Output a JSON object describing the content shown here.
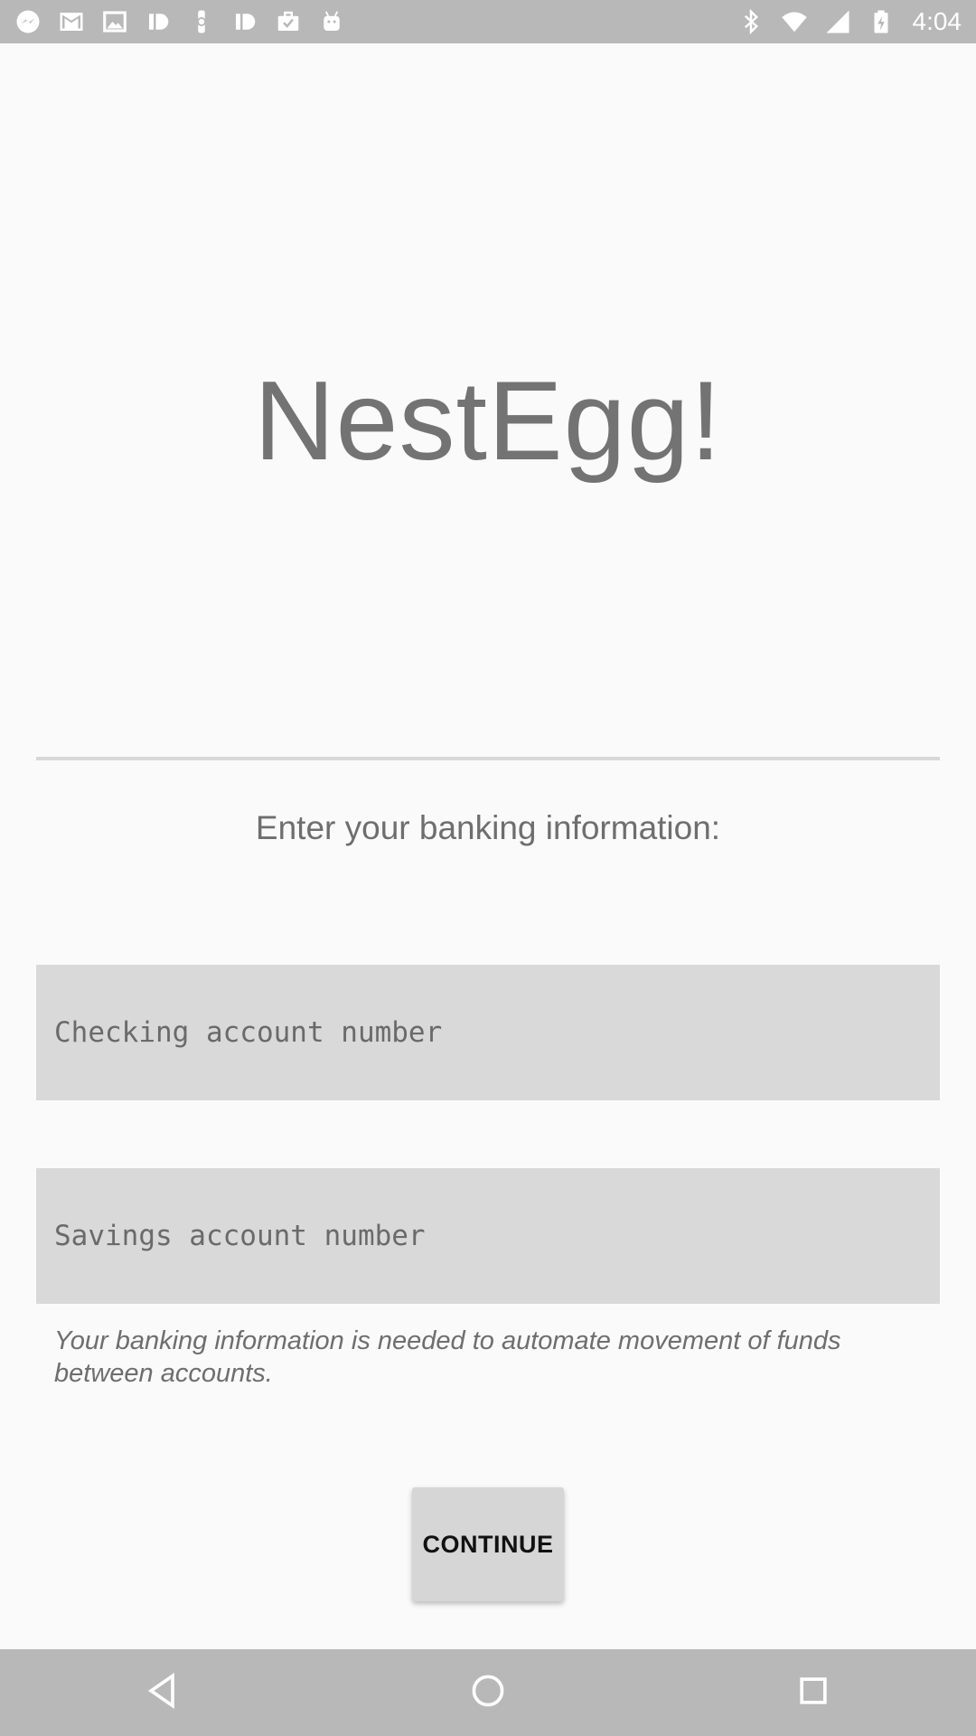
{
  "status_bar": {
    "notification_icons": [
      "messenger-icon",
      "gmail-icon",
      "photos-icon",
      "id-icon",
      "watch-icon",
      "id-icon",
      "briefcase-icon",
      "android-icon"
    ],
    "system_icons": [
      "bluetooth-icon",
      "wifi-icon",
      "signal-icon",
      "battery-charging-icon"
    ],
    "time": "4:04"
  },
  "app": {
    "title": "NestEgg!",
    "prompt": "Enter your banking information:"
  },
  "form": {
    "checking_placeholder": "Checking account number",
    "checking_value": "",
    "savings_placeholder": "Savings account number",
    "savings_value": "",
    "helper_text": "Your banking information is needed to automate movement of funds between accounts.",
    "continue_label": "CONTINUE"
  },
  "nav_bar": {
    "buttons": [
      "back-icon",
      "home-icon",
      "recents-icon"
    ]
  },
  "colors": {
    "background": "#fafafa",
    "bar_gray": "#b8b8b8",
    "field_gray": "#d9d9d9",
    "text_gray": "#737373"
  }
}
